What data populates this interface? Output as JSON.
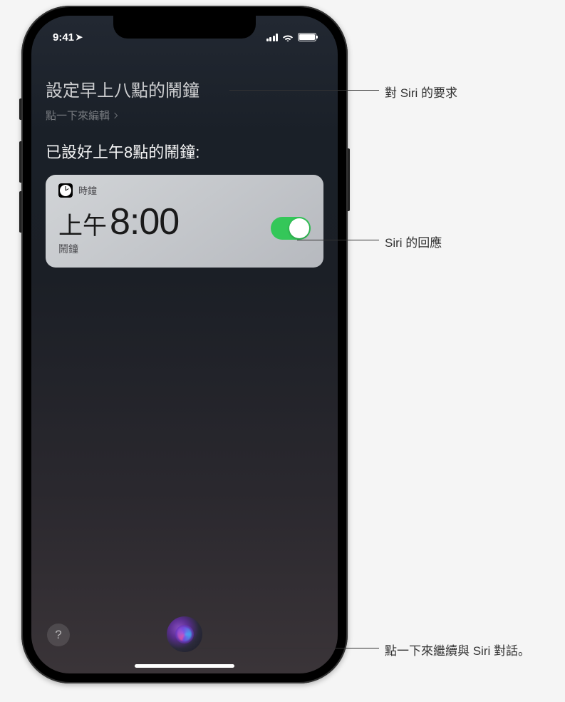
{
  "status_bar": {
    "time": "9:41",
    "location_icon": "➤"
  },
  "siri": {
    "user_request": "設定早上八點的鬧鐘",
    "edit_hint": "點一下來編輯",
    "response": "已設好上午8點的鬧鐘:"
  },
  "clock_card": {
    "app_name": "時鐘",
    "period": "上午",
    "time": "8:00",
    "label": "鬧鐘",
    "toggle_on": true
  },
  "help": {
    "symbol": "?"
  },
  "callouts": {
    "request": "對 Siri 的要求",
    "response": "Siri 的回應",
    "continue": "點一下來繼續與 Siri 對話。"
  }
}
